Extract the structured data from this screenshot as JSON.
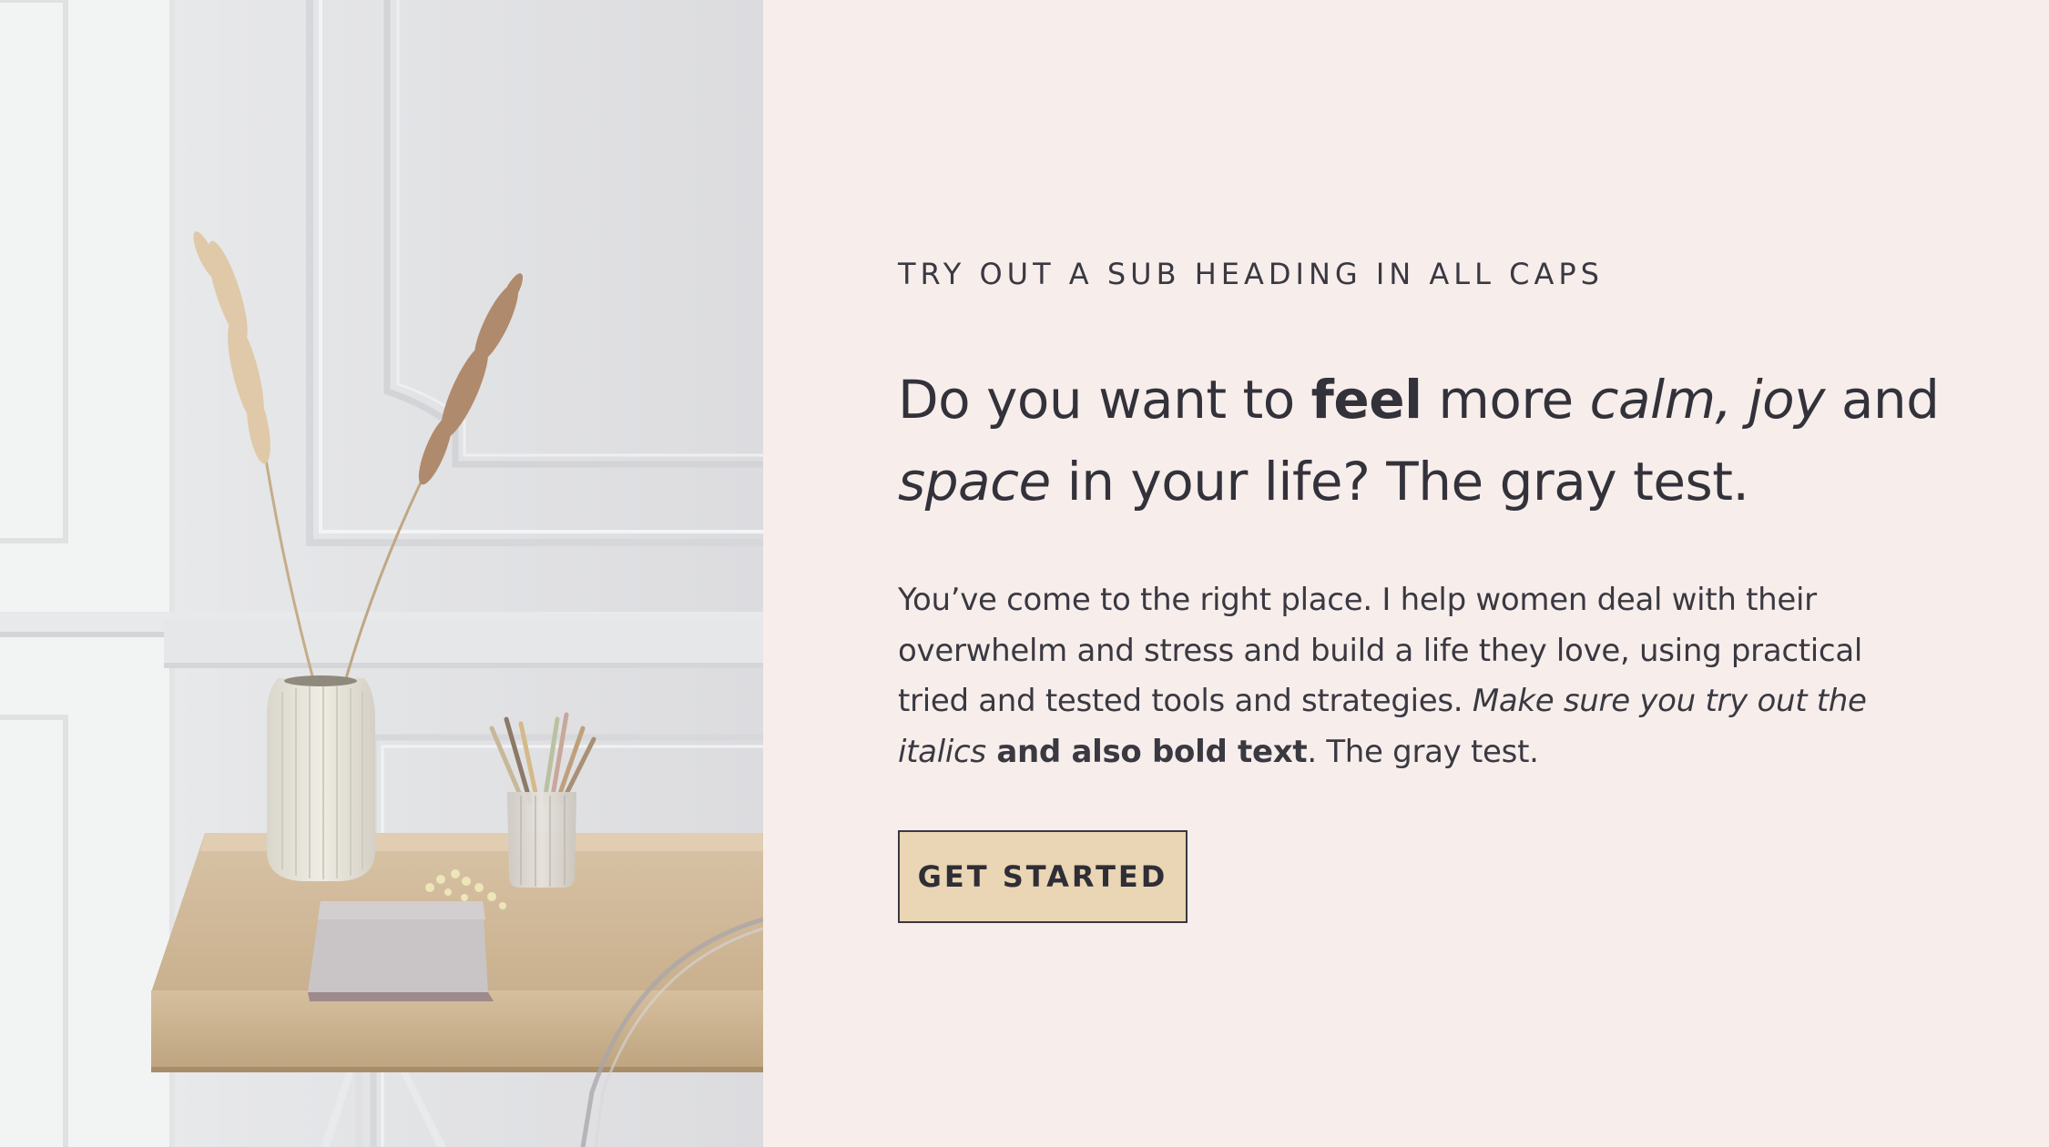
{
  "photo": {
    "alt_subject": "desk-with-vase-and-pencils"
  },
  "hero": {
    "sub_heading": "TRY OUT A SUB HEADING IN ALL CAPS",
    "headline": {
      "part1": "Do you want to ",
      "bold1": "feel",
      "part2": " more ",
      "italic1": "calm, joy",
      "part3": " and ",
      "italic2": "space",
      "part4": " in your life? The gray test."
    },
    "body": {
      "part1": "You’ve come to the right place. I help women deal with their overwhelm and stress and build a life they love, using practical tried and tested tools and strategies. ",
      "italic1": "Make sure you try out the italics",
      "bold1": " and also bold text",
      "part2": ". The gray test."
    },
    "cta_label": "GET STARTED"
  },
  "colors": {
    "background": "#f7eeec",
    "text": "#33323a",
    "button_fill": "#ead5b4",
    "button_border": "#3a3941"
  }
}
